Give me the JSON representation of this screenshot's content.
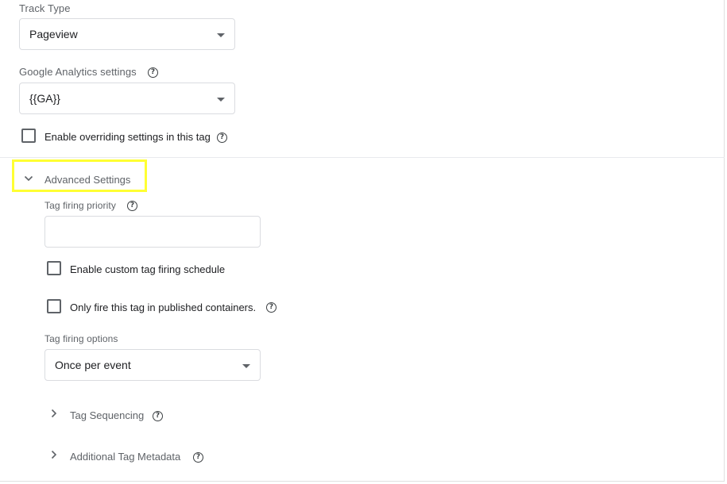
{
  "track_type": {
    "label": "Track Type",
    "value": "Pageview"
  },
  "ga_settings": {
    "label": "Google Analytics settings",
    "value": "{{GA}}"
  },
  "override": {
    "label": "Enable overriding settings in this tag"
  },
  "advanced": {
    "title": "Advanced Settings",
    "priority_label": "Tag firing priority",
    "priority_value": "",
    "custom_schedule_label": "Enable custom tag firing schedule",
    "published_only_label": "Only fire this tag in published containers.",
    "firing_options_label": "Tag firing options",
    "firing_options_value": "Once per event",
    "tag_sequencing_label": "Tag Sequencing",
    "metadata_label": "Additional Tag Metadata"
  },
  "icons": {
    "help": "help-circle-icon",
    "dropdown": "arrow-drop-down-icon",
    "expand_less": "chevron-down-icon",
    "expand_more": "chevron-right-icon"
  },
  "colors": {
    "highlight": "#ffff33",
    "border": "#dadce0",
    "text": "#202124",
    "muted": "#5f6368"
  }
}
